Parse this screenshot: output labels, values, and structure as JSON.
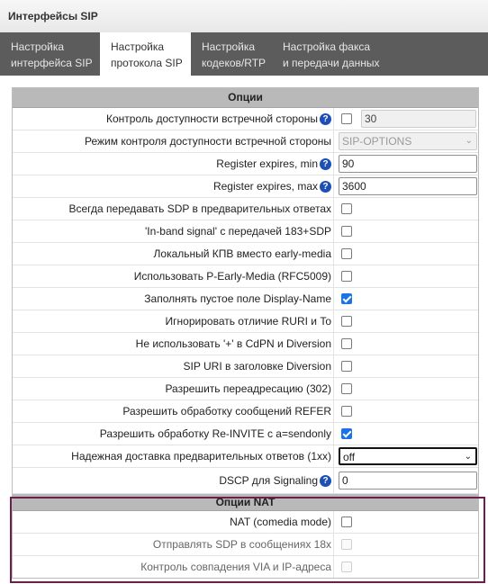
{
  "header": {
    "title": "Интерфейсы SIP"
  },
  "tabs": [
    {
      "line1": "Настройка",
      "line2": "интерфейса SIP"
    },
    {
      "line1": "Настройка",
      "line2": "протокола SIP"
    },
    {
      "line1": "Настройка",
      "line2": "кодеков/RTP"
    },
    {
      "line1": "Настройка факса",
      "line2": "и передачи данных"
    }
  ],
  "options": {
    "title": "Опции",
    "rows": {
      "availability_control": {
        "label": "Контроль доступности встречной стороны",
        "value": "30",
        "checked": false
      },
      "availability_mode": {
        "label": "Режим контроля доступности встречной стороны",
        "value": "SIP-OPTIONS"
      },
      "register_expires_min": {
        "label": "Register expires, min",
        "value": "90"
      },
      "register_expires_max": {
        "label": "Register expires, max",
        "value": "3600"
      },
      "sdp_in_provisional": {
        "label": "Всегда передавать SDP в предварительных ответах",
        "checked": false
      },
      "inband_signal_183": {
        "label": "'In-band signal' с передачей 183+SDP",
        "checked": false
      },
      "local_kpv": {
        "label": "Локальный КПВ вместо early-media",
        "checked": false
      },
      "p_early_media": {
        "label": "Использовать P-Early-Media (RFC5009)",
        "checked": false
      },
      "fill_display_name": {
        "label": "Заполнять пустое поле Display-Name",
        "checked": true
      },
      "ignore_ruri_to": {
        "label": "Игнорировать отличие RURI и To",
        "checked": false
      },
      "no_plus_cdpn": {
        "label": "Не использовать '+' в CdPN и Diversion",
        "checked": false
      },
      "sip_uri_diversion": {
        "label": "SIP URI в заголовке Diversion",
        "checked": false
      },
      "allow_redirect": {
        "label": "Разрешить переадресацию (302)",
        "checked": false
      },
      "allow_refer": {
        "label": "Разрешить обработку сообщений REFER",
        "checked": false
      },
      "allow_reinvite_sendonly": {
        "label": "Разрешить обработку Re-INVITE с a=sendonly",
        "checked": true
      },
      "reliable_provisional": {
        "label": "Надежная доставка предварительных ответов (1xx)",
        "value": "off"
      },
      "dscp_signaling": {
        "label": "DSCP для Signaling",
        "value": "0"
      }
    }
  },
  "nat": {
    "title": "Опции NAT",
    "rows": {
      "comedia": {
        "label": "NAT (comedia mode)",
        "checked": false
      },
      "sdp_18x": {
        "label": "Отправлять SDP в сообщениях 18х",
        "checked": false
      },
      "via_ip_match": {
        "label": "Контроль совпадения VIA и IP-адреса",
        "checked": false
      }
    }
  },
  "icons": {
    "help": "help-icon",
    "dropdown": "chevron-down-icon"
  },
  "colors": {
    "accent_checkbox": "#1a73e8",
    "help_icon": "#1d4fb5",
    "nat_highlight": "#6b1f4a",
    "tabs_bg": "#5c5c5c"
  }
}
